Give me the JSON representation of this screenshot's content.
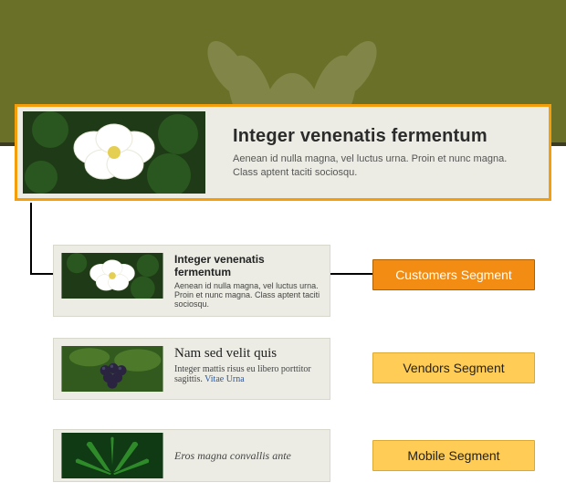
{
  "main_card": {
    "title": "Integer venenatis fermentum",
    "desc": "Aenean id nulla magna, vel luctus urna. Proin et nunc magna. Class aptent taciti sociosqu."
  },
  "variants": [
    {
      "title": "Integer venenatis fermentum",
      "desc": "Aenean id nulla magna, vel luctus urna. Proin et nunc magna. Class aptent taciti sociosqu.",
      "link": ""
    },
    {
      "title": "Nam sed velit quis",
      "desc": "Integer mattis risus eu libero porttitor sagittis. ",
      "link": "Vitae Urna"
    },
    {
      "title": "",
      "desc": "Eros magna convallis ante",
      "link": ""
    }
  ],
  "segments": [
    {
      "label": "Customers Segment"
    },
    {
      "label": "Vendors Segment"
    },
    {
      "label": "Mobile Segment"
    }
  ]
}
